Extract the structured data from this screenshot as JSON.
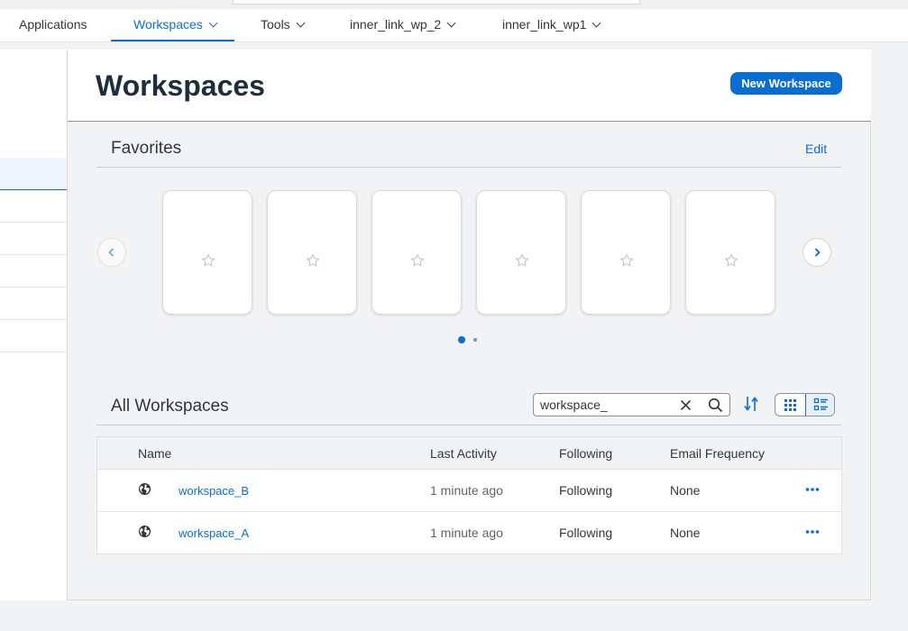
{
  "nav": {
    "items": [
      {
        "label": "Applications",
        "has_menu": false,
        "active": false
      },
      {
        "label": "Workspaces",
        "has_menu": true,
        "active": true
      },
      {
        "label": "Tools",
        "has_menu": true,
        "active": false
      },
      {
        "label": "inner_link_wp_2",
        "has_menu": true,
        "active": false
      },
      {
        "label": "inner_link_wp1",
        "has_menu": true,
        "active": false
      }
    ]
  },
  "header": {
    "title": "Workspaces",
    "new_button_label": "New Workspace"
  },
  "favorites": {
    "title": "Favorites",
    "edit_label": "Edit",
    "cards": 6,
    "card_icon": "star-outline-icon",
    "pages": 2,
    "current_page": 1
  },
  "all_workspaces": {
    "title": "All Workspaces",
    "search": {
      "value": "workspace_"
    },
    "view_mode": "list",
    "columns": [
      "Name",
      "Last Activity",
      "Following",
      "Email Frequency"
    ],
    "rows": [
      {
        "icon": "globe-icon",
        "name": "workspace_B",
        "last_activity": "1 minute ago",
        "following": "Following",
        "email_frequency": "None"
      },
      {
        "icon": "globe-icon",
        "name": "workspace_A",
        "last_activity": "1 minute ago",
        "following": "Following",
        "email_frequency": "None"
      }
    ]
  },
  "colors": {
    "accent": "#0a6ed1",
    "background": "#f2f3f5",
    "title": "#1d2d3e"
  }
}
